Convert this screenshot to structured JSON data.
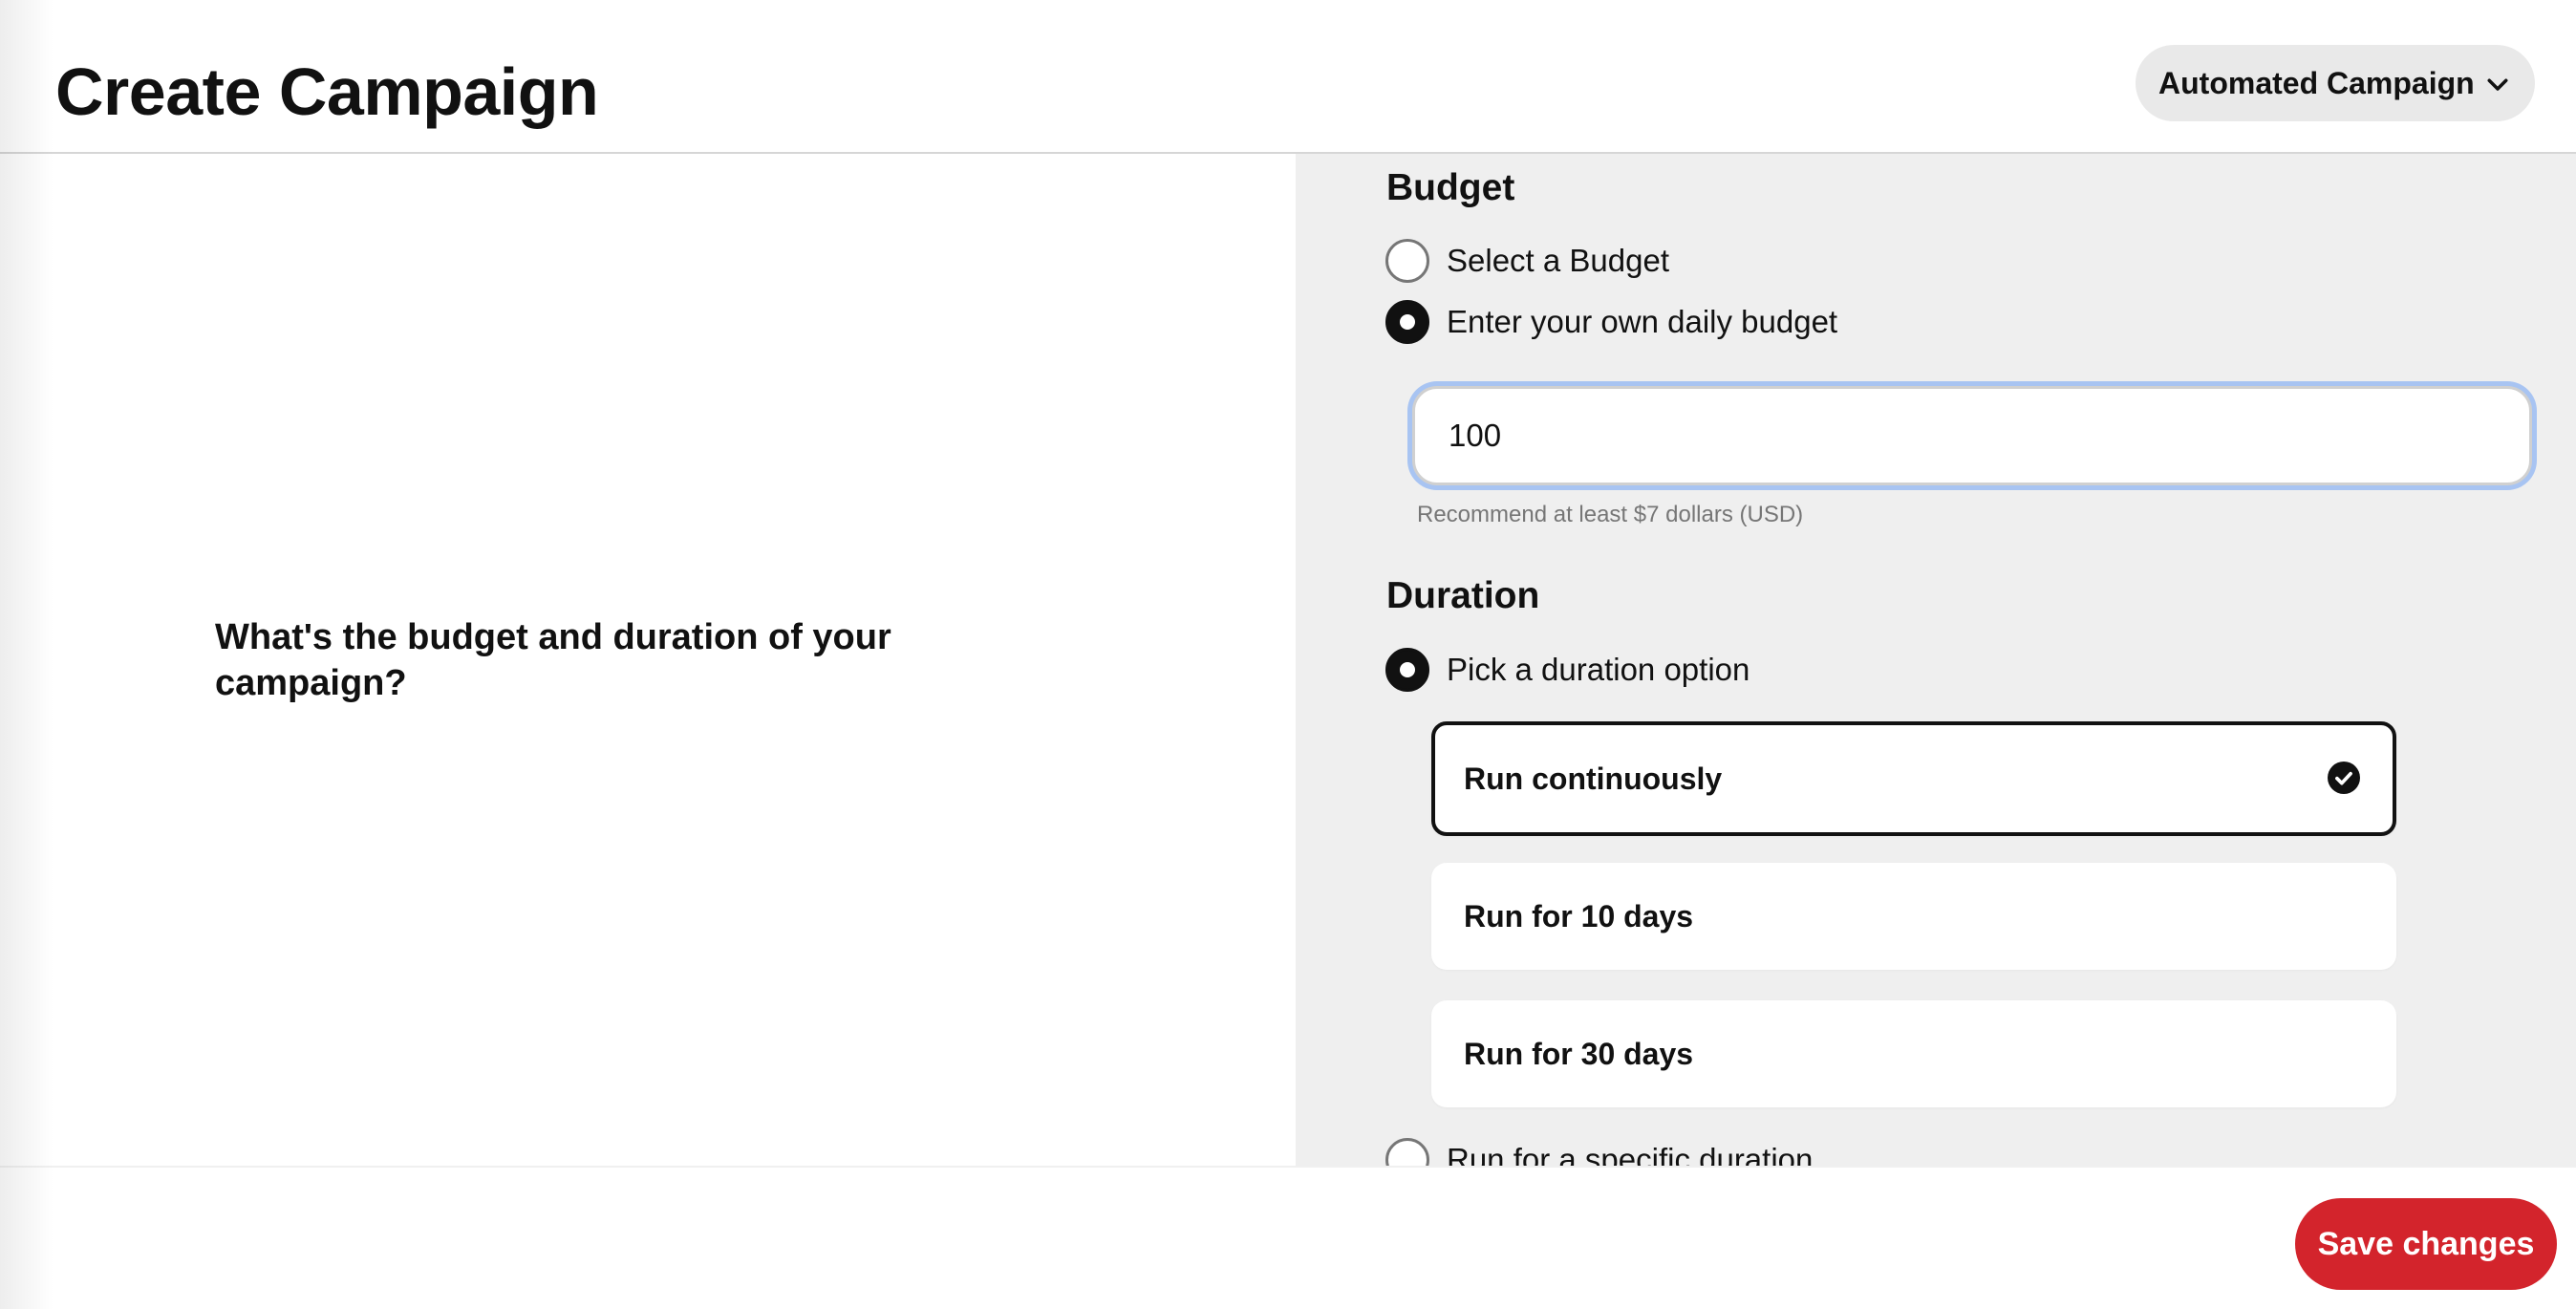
{
  "header": {
    "title": "Create Campaign",
    "campaign_type": "Automated Campaign"
  },
  "left": {
    "question": "What's the budget and duration of your campaign?"
  },
  "budget": {
    "title": "Budget",
    "options": [
      {
        "label": "Select a Budget",
        "checked": false
      },
      {
        "label": "Enter your own daily budget",
        "checked": true
      }
    ],
    "input_value": "100",
    "hint": "Recommend at least $7 dollars (USD)"
  },
  "duration": {
    "title": "Duration",
    "pick_option_label": "Pick a duration option",
    "cards": [
      {
        "label": "Run continuously",
        "selected": true
      },
      {
        "label": "Run for 10 days",
        "selected": false
      },
      {
        "label": "Run for 30 days",
        "selected": false
      }
    ],
    "specific_label": "Run for a specific duration"
  },
  "footer": {
    "save_label": "Save changes"
  },
  "colors": {
    "accent_red": "#d3242c",
    "focus_ring": "#a8c4f2",
    "panel_gray": "#efefef"
  }
}
